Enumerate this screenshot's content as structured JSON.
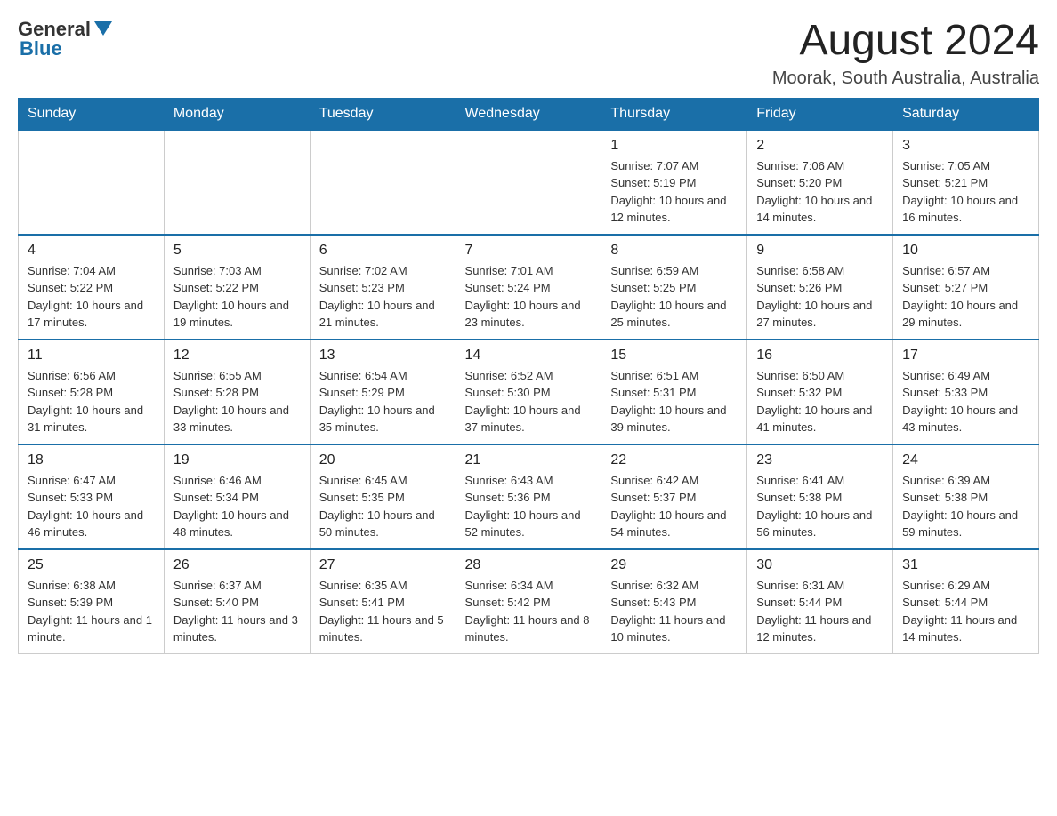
{
  "header": {
    "logo_general": "General",
    "logo_blue": "Blue",
    "month_title": "August 2024",
    "location": "Moorak, South Australia, Australia"
  },
  "weekdays": [
    "Sunday",
    "Monday",
    "Tuesday",
    "Wednesday",
    "Thursday",
    "Friday",
    "Saturday"
  ],
  "weeks": [
    [
      {
        "day": "",
        "info": ""
      },
      {
        "day": "",
        "info": ""
      },
      {
        "day": "",
        "info": ""
      },
      {
        "day": "",
        "info": ""
      },
      {
        "day": "1",
        "info": "Sunrise: 7:07 AM\nSunset: 5:19 PM\nDaylight: 10 hours and 12 minutes."
      },
      {
        "day": "2",
        "info": "Sunrise: 7:06 AM\nSunset: 5:20 PM\nDaylight: 10 hours and 14 minutes."
      },
      {
        "day": "3",
        "info": "Sunrise: 7:05 AM\nSunset: 5:21 PM\nDaylight: 10 hours and 16 minutes."
      }
    ],
    [
      {
        "day": "4",
        "info": "Sunrise: 7:04 AM\nSunset: 5:22 PM\nDaylight: 10 hours and 17 minutes."
      },
      {
        "day": "5",
        "info": "Sunrise: 7:03 AM\nSunset: 5:22 PM\nDaylight: 10 hours and 19 minutes."
      },
      {
        "day": "6",
        "info": "Sunrise: 7:02 AM\nSunset: 5:23 PM\nDaylight: 10 hours and 21 minutes."
      },
      {
        "day": "7",
        "info": "Sunrise: 7:01 AM\nSunset: 5:24 PM\nDaylight: 10 hours and 23 minutes."
      },
      {
        "day": "8",
        "info": "Sunrise: 6:59 AM\nSunset: 5:25 PM\nDaylight: 10 hours and 25 minutes."
      },
      {
        "day": "9",
        "info": "Sunrise: 6:58 AM\nSunset: 5:26 PM\nDaylight: 10 hours and 27 minutes."
      },
      {
        "day": "10",
        "info": "Sunrise: 6:57 AM\nSunset: 5:27 PM\nDaylight: 10 hours and 29 minutes."
      }
    ],
    [
      {
        "day": "11",
        "info": "Sunrise: 6:56 AM\nSunset: 5:28 PM\nDaylight: 10 hours and 31 minutes."
      },
      {
        "day": "12",
        "info": "Sunrise: 6:55 AM\nSunset: 5:28 PM\nDaylight: 10 hours and 33 minutes."
      },
      {
        "day": "13",
        "info": "Sunrise: 6:54 AM\nSunset: 5:29 PM\nDaylight: 10 hours and 35 minutes."
      },
      {
        "day": "14",
        "info": "Sunrise: 6:52 AM\nSunset: 5:30 PM\nDaylight: 10 hours and 37 minutes."
      },
      {
        "day": "15",
        "info": "Sunrise: 6:51 AM\nSunset: 5:31 PM\nDaylight: 10 hours and 39 minutes."
      },
      {
        "day": "16",
        "info": "Sunrise: 6:50 AM\nSunset: 5:32 PM\nDaylight: 10 hours and 41 minutes."
      },
      {
        "day": "17",
        "info": "Sunrise: 6:49 AM\nSunset: 5:33 PM\nDaylight: 10 hours and 43 minutes."
      }
    ],
    [
      {
        "day": "18",
        "info": "Sunrise: 6:47 AM\nSunset: 5:33 PM\nDaylight: 10 hours and 46 minutes."
      },
      {
        "day": "19",
        "info": "Sunrise: 6:46 AM\nSunset: 5:34 PM\nDaylight: 10 hours and 48 minutes."
      },
      {
        "day": "20",
        "info": "Sunrise: 6:45 AM\nSunset: 5:35 PM\nDaylight: 10 hours and 50 minutes."
      },
      {
        "day": "21",
        "info": "Sunrise: 6:43 AM\nSunset: 5:36 PM\nDaylight: 10 hours and 52 minutes."
      },
      {
        "day": "22",
        "info": "Sunrise: 6:42 AM\nSunset: 5:37 PM\nDaylight: 10 hours and 54 minutes."
      },
      {
        "day": "23",
        "info": "Sunrise: 6:41 AM\nSunset: 5:38 PM\nDaylight: 10 hours and 56 minutes."
      },
      {
        "day": "24",
        "info": "Sunrise: 6:39 AM\nSunset: 5:38 PM\nDaylight: 10 hours and 59 minutes."
      }
    ],
    [
      {
        "day": "25",
        "info": "Sunrise: 6:38 AM\nSunset: 5:39 PM\nDaylight: 11 hours and 1 minute."
      },
      {
        "day": "26",
        "info": "Sunrise: 6:37 AM\nSunset: 5:40 PM\nDaylight: 11 hours and 3 minutes."
      },
      {
        "day": "27",
        "info": "Sunrise: 6:35 AM\nSunset: 5:41 PM\nDaylight: 11 hours and 5 minutes."
      },
      {
        "day": "28",
        "info": "Sunrise: 6:34 AM\nSunset: 5:42 PM\nDaylight: 11 hours and 8 minutes."
      },
      {
        "day": "29",
        "info": "Sunrise: 6:32 AM\nSunset: 5:43 PM\nDaylight: 11 hours and 10 minutes."
      },
      {
        "day": "30",
        "info": "Sunrise: 6:31 AM\nSunset: 5:44 PM\nDaylight: 11 hours and 12 minutes."
      },
      {
        "day": "31",
        "info": "Sunrise: 6:29 AM\nSunset: 5:44 PM\nDaylight: 11 hours and 14 minutes."
      }
    ]
  ]
}
